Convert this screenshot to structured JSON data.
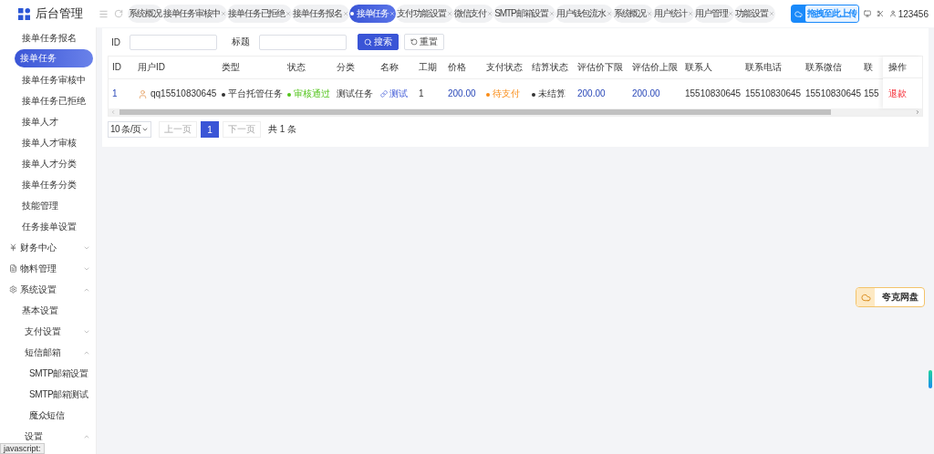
{
  "logo": {
    "title": "后台管理"
  },
  "tabs": [
    {
      "label": "系统概况",
      "selected": false,
      "closable": false
    },
    {
      "label": "接单任务审核中",
      "selected": false,
      "closable": true
    },
    {
      "label": "接单任务已拒绝",
      "selected": false,
      "closable": true
    },
    {
      "label": "接单任务报名",
      "selected": false,
      "closable": true
    },
    {
      "label": "接单任务",
      "selected": true,
      "closable": true
    },
    {
      "label": "支付功能设置",
      "selected": false,
      "closable": true
    },
    {
      "label": "微信支付",
      "selected": false,
      "closable": true
    },
    {
      "label": "SMTP邮箱设置",
      "selected": false,
      "closable": true
    },
    {
      "label": "用户钱包流水",
      "selected": false,
      "closable": true
    },
    {
      "label": "系统概况",
      "selected": false,
      "closable": true
    },
    {
      "label": "用户统计",
      "selected": false,
      "closable": true
    },
    {
      "label": "用户管理",
      "selected": false,
      "closable": true
    },
    {
      "label": "功能设置",
      "selected": false,
      "closable": true
    }
  ],
  "upload_button": {
    "label": "拖拽至此上传"
  },
  "user": {
    "name": "123456"
  },
  "sidebar": {
    "items": [
      {
        "kind": "link",
        "label": "接单任务报名",
        "selected": false
      },
      {
        "kind": "link",
        "label": "接单任务",
        "selected": true
      },
      {
        "kind": "link",
        "label": "接单任务审核中",
        "selected": false
      },
      {
        "kind": "link",
        "label": "接单任务已拒绝",
        "selected": false
      },
      {
        "kind": "link",
        "label": "接单人才",
        "selected": false
      },
      {
        "kind": "link",
        "label": "接单人才审核",
        "selected": false
      },
      {
        "kind": "link",
        "label": "接单人才分类",
        "selected": false
      },
      {
        "kind": "link",
        "label": "接单任务分类",
        "selected": false
      },
      {
        "kind": "link",
        "label": "技能管理",
        "selected": false
      },
      {
        "kind": "link",
        "label": "任务接单设置",
        "selected": false
      },
      {
        "kind": "group",
        "label": "财务中心",
        "expanded": false
      },
      {
        "kind": "group",
        "label": "物料管理",
        "expanded": false
      },
      {
        "kind": "group",
        "label": "系统设置",
        "expanded": true,
        "children": [
          {
            "kind": "link",
            "label": "基本设置",
            "selected": false
          },
          {
            "kind": "group",
            "label": "支付设置",
            "expanded": false
          },
          {
            "kind": "group",
            "label": "短信邮箱",
            "expanded": true,
            "children": [
              {
                "kind": "link",
                "label": "SMTP邮箱设置",
                "selected": false
              },
              {
                "kind": "link",
                "label": "SMTP邮箱测试",
                "selected": false
              },
              {
                "kind": "link",
                "label": "魔众短信",
                "selected": false
              }
            ]
          },
          {
            "kind": "group",
            "label": "设置",
            "expanded": true
          }
        ]
      }
    ]
  },
  "status_text": "javascript:",
  "filters": [
    {
      "label": "ID"
    },
    {
      "label": "标题"
    }
  ],
  "search_button": "搜索",
  "reset_button": "重置",
  "table": {
    "columns": [
      "ID",
      "用户ID",
      "类型",
      "状态",
      "分类",
      "名称",
      "工期",
      "价格",
      "支付状态",
      "结算状态",
      "评估价下限",
      "评估价上限",
      "联系人",
      "联系电话",
      "联系微信",
      "联"
    ],
    "action_column": "操作",
    "rows": [
      {
        "id": "1",
        "user": "qq15510830645",
        "type": {
          "text": "平台托管任务",
          "color": "#333333"
        },
        "status": {
          "text": "审核通过",
          "color": "#52c41a"
        },
        "category": "测试任务",
        "name": "测试",
        "period": "1",
        "price": "200.00",
        "pay_status": {
          "text": "待支付",
          "color": "#fa8c16"
        },
        "settle_status": {
          "text": "未结算",
          "color": "#333333"
        },
        "low": "200.00",
        "high": "200.00",
        "contact": "15510830645",
        "phone": "15510830645",
        "wechat": "15510830645",
        "col_16": "155",
        "action": "退款"
      }
    ]
  },
  "pagination": {
    "page_size": "10 条/页",
    "prev": "上一页",
    "pages": [
      {
        "label": "1",
        "selected": true
      }
    ],
    "next": "下一页",
    "total": "共 1 条"
  },
  "floating_widget": {
    "label": "夸克网盘"
  }
}
